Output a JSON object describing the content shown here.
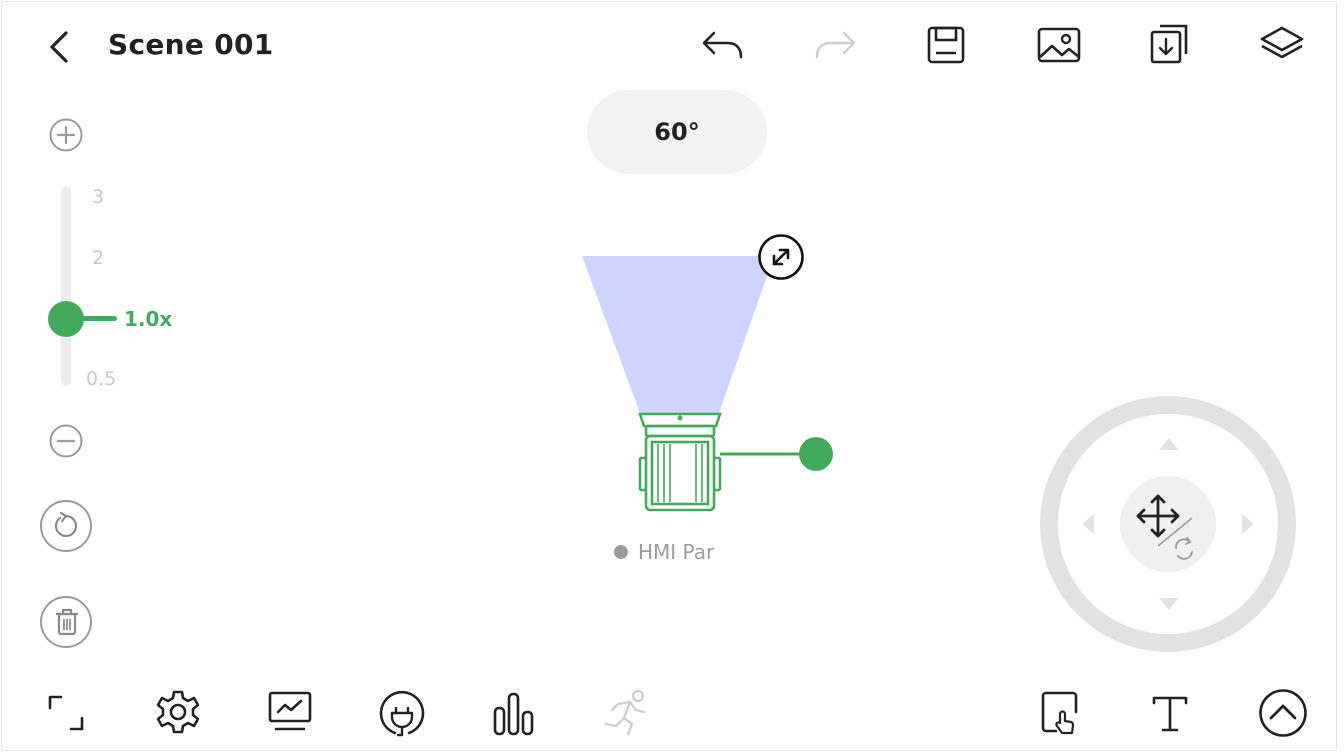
{
  "header": {
    "title": "Scene 001",
    "back_icon": "chevron-left-icon",
    "actions": [
      "undo-icon",
      "redo-icon",
      "save-icon",
      "image-icon",
      "import-icon",
      "layers-icon"
    ]
  },
  "canvas": {
    "beam_angle": "60°",
    "light": {
      "name": "HMI Par",
      "color": "#43a95c",
      "beam_color": "#cdd4fd"
    }
  },
  "zoom": {
    "ticks": [
      "3",
      "2",
      "0.5"
    ],
    "value": "1.0x",
    "accent": "#43a95c"
  },
  "left_tools": [
    "zoom-in-icon",
    "zoom-out-icon",
    "reset-rotate-icon",
    "trash-icon"
  ],
  "joystick": {
    "center_icon": "move-rotate-icon",
    "arrows": [
      "up",
      "down",
      "left",
      "right"
    ]
  },
  "bottom_toolbar": {
    "left": [
      "fullscreen-icon",
      "settings-icon",
      "monitor-icon",
      "power-plug-icon",
      "bars-chart-icon",
      "running-icon"
    ],
    "right": [
      "touch-select-icon",
      "text-icon",
      "chevron-up-circle-icon"
    ]
  }
}
